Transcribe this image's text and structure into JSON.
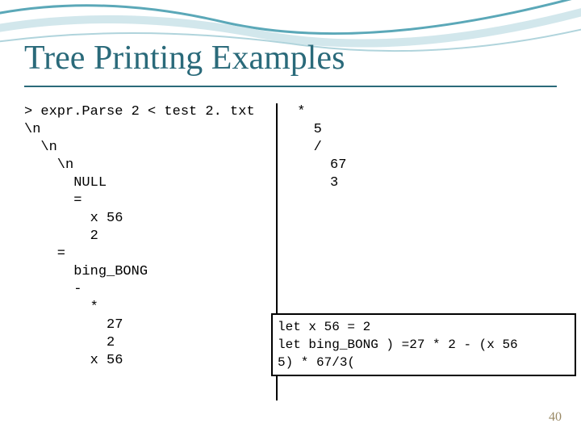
{
  "title": "Tree Printing Examples",
  "left_tree": "> expr.Parse 2 < test 2. txt\n\\n\n  \\n\n    \\n\n      NULL\n      =\n        x 56\n        2\n    =\n      bing_BONG\n      -\n        *\n          27\n          2\n        x 56",
  "right_tree": " *\n   5\n   /\n     67\n     3",
  "boxed_code": "let x 56 = 2\nlet bing_BONG ) =27 * 2 - (x 56\n5) * 67/3(",
  "page_number": "40"
}
